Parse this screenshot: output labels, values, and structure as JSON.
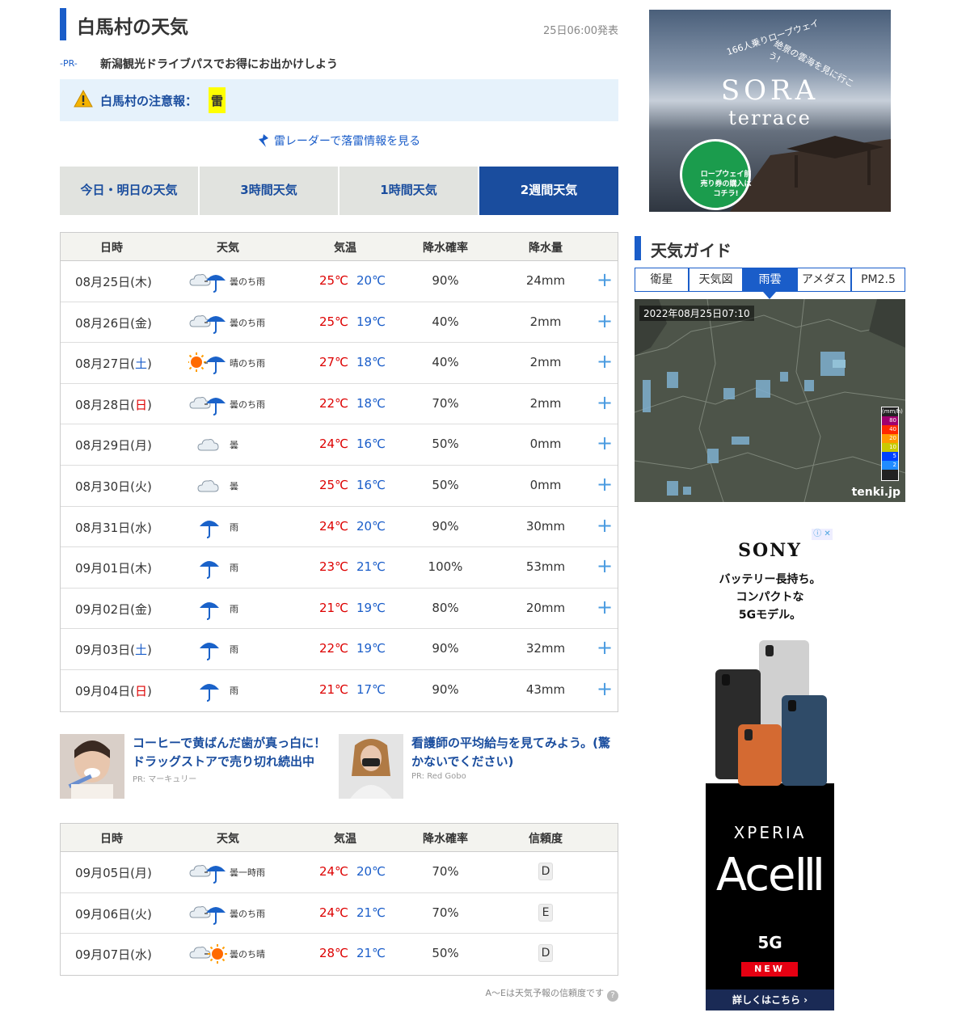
{
  "page": {
    "title": "白馬村の天気",
    "announced": "25日06:00発表",
    "pr": {
      "tag": "-PR-",
      "text": "新潟観光ドライブパスでお得にお出かけしよう"
    },
    "alert": {
      "label": "白馬村の注意報：",
      "badge": "雷"
    },
    "radar_link": "雷レーダーで落雷情報を見る",
    "tabs": [
      "今日・明日の天気",
      "3時間天気",
      "1時間天気",
      "2週間天気"
    ],
    "active_tab": 3
  },
  "table1": {
    "headers": [
      "日時",
      "天気",
      "気温",
      "降水確率",
      "降水量"
    ],
    "rows": [
      {
        "date": "08月25日(",
        "dow": "木",
        "dow_type": "normal",
        "weather": "曇のち雨",
        "icon": "cloud-then-rain-icon",
        "hi": "25℃",
        "lo": "20℃",
        "pop": "90%",
        "amount": "24mm"
      },
      {
        "date": "08月26日(",
        "dow": "金",
        "dow_type": "normal",
        "weather": "曇のち雨",
        "icon": "cloud-then-rain-icon",
        "hi": "25℃",
        "lo": "19℃",
        "pop": "40%",
        "amount": "2mm"
      },
      {
        "date": "08月27日(",
        "dow": "土",
        "dow_type": "sat",
        "weather": "晴のち雨",
        "icon": "sun-then-rain-icon",
        "hi": "27℃",
        "lo": "18℃",
        "pop": "40%",
        "amount": "2mm"
      },
      {
        "date": "08月28日(",
        "dow": "日",
        "dow_type": "sun",
        "weather": "曇のち雨",
        "icon": "cloud-then-rain-icon",
        "hi": "22℃",
        "lo": "18℃",
        "pop": "70%",
        "amount": "2mm"
      },
      {
        "date": "08月29日(",
        "dow": "月",
        "dow_type": "normal",
        "weather": "曇",
        "icon": "cloud-icon",
        "hi": "24℃",
        "lo": "16℃",
        "pop": "50%",
        "amount": "0mm"
      },
      {
        "date": "08月30日(",
        "dow": "火",
        "dow_type": "normal",
        "weather": "曇",
        "icon": "cloud-icon",
        "hi": "25℃",
        "lo": "16℃",
        "pop": "50%",
        "amount": "0mm"
      },
      {
        "date": "08月31日(",
        "dow": "水",
        "dow_type": "normal",
        "weather": "雨",
        "icon": "umbrella-icon",
        "hi": "24℃",
        "lo": "20℃",
        "pop": "90%",
        "amount": "30mm"
      },
      {
        "date": "09月01日(",
        "dow": "木",
        "dow_type": "normal",
        "weather": "雨",
        "icon": "umbrella-icon",
        "hi": "23℃",
        "lo": "21℃",
        "pop": "100%",
        "amount": "53mm"
      },
      {
        "date": "09月02日(",
        "dow": "金",
        "dow_type": "normal",
        "weather": "雨",
        "icon": "umbrella-icon",
        "hi": "21℃",
        "lo": "19℃",
        "pop": "80%",
        "amount": "20mm"
      },
      {
        "date": "09月03日(",
        "dow": "土",
        "dow_type": "sat",
        "weather": "雨",
        "icon": "umbrella-icon",
        "hi": "22℃",
        "lo": "19℃",
        "pop": "90%",
        "amount": "32mm"
      },
      {
        "date": "09月04日(",
        "dow": "日",
        "dow_type": "sun",
        "weather": "雨",
        "icon": "umbrella-icon",
        "hi": "21℃",
        "lo": "17℃",
        "pop": "90%",
        "amount": "43mm"
      }
    ]
  },
  "ads": [
    {
      "title": "コーヒーで黄ばんだ歯が真っ白に！ドラッグストアで売り切れ続出中",
      "source": "PR: マーキュリー"
    },
    {
      "title": "看護師の平均給与を見てみよう。(驚かないでください)",
      "source": "PR: Red Gobo"
    }
  ],
  "table2": {
    "headers": [
      "日時",
      "天気",
      "気温",
      "降水確率",
      "信頼度"
    ],
    "rows": [
      {
        "date": "09月05日(",
        "dow": "月",
        "dow_type": "normal",
        "weather": "曇一時雨",
        "icon": "cloud-sometimes-rain-icon",
        "hi": "24℃",
        "lo": "20℃",
        "pop": "70%",
        "rel": "D"
      },
      {
        "date": "09月06日(",
        "dow": "火",
        "dow_type": "normal",
        "weather": "曇のち雨",
        "icon": "cloud-then-rain-icon",
        "hi": "24℃",
        "lo": "21℃",
        "pop": "70%",
        "rel": "E"
      },
      {
        "date": "09月07日(",
        "dow": "水",
        "dow_type": "normal",
        "weather": "曇のち晴",
        "icon": "cloud-then-sun-icon",
        "hi": "28℃",
        "lo": "21℃",
        "pop": "50%",
        "rel": "D"
      }
    ],
    "note": "A〜Eは天気予報の信頼度です",
    "note_q": "?"
  },
  "side": {
    "sora": {
      "logo": "SORA",
      "logo2": "terrace",
      "arc": "166人乗りロープウェイ",
      "arc2": "絶景の雲海を見に行こう!",
      "circle": "ロープウェイ前売り券の購入はコチラ!"
    },
    "guide_title": "天気ガイド",
    "guide_tabs": [
      "衛星",
      "天気図",
      "雨雲",
      "アメダス",
      "PM2.5"
    ],
    "active_guide_tab": 2,
    "radar": {
      "time": "2022年08月25日07:10",
      "brand": "tenki.jp",
      "legend": [
        "(mm/h)",
        "80",
        "40",
        "20",
        "10",
        "5",
        "2"
      ]
    },
    "sony": {
      "logo": "SONY",
      "copy": [
        "バッテリー長持ち。",
        "コンパクトな",
        "5Gモデル。"
      ],
      "xperia": "XPERIA",
      "ace": "AceⅢ",
      "fiveg": "5G",
      "new": "NEW",
      "cta": "詳しくはこちら ›",
      "close": "ⓘ ✕"
    }
  },
  "colors": {
    "accent": "#1a5dc9",
    "dark_accent": "#1a4d9e",
    "hi_temp": "#dd0000",
    "lo_temp": "#1a5dc9",
    "alert_bg": "#e6f2fb",
    "tab_bg": "#e1e3df"
  }
}
